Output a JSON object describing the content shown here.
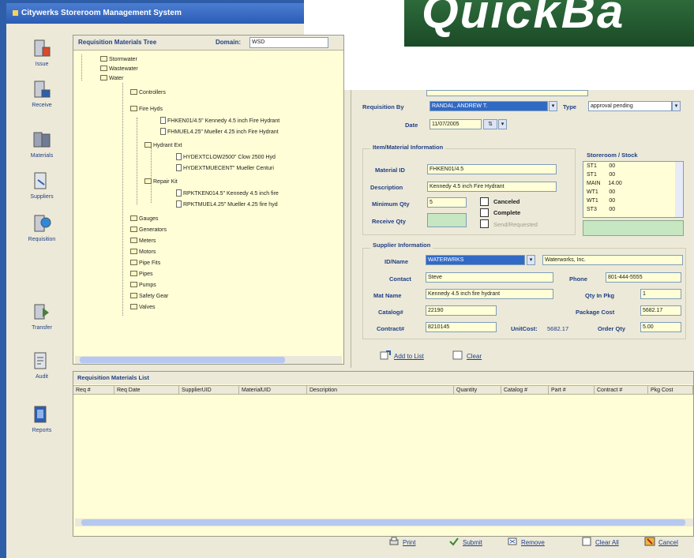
{
  "window": {
    "title": "Citywerks Storeroom Management System"
  },
  "logo": {
    "text": "QuickBa"
  },
  "toolbar": [
    {
      "label": "Issue",
      "icon": "issue-icon"
    },
    {
      "label": "Receive",
      "icon": "receive-icon"
    },
    {
      "label": "Materials",
      "icon": "materials-icon"
    },
    {
      "label": "Suppliers",
      "icon": "suppliers-icon"
    },
    {
      "label": "Requisition",
      "icon": "requisition-icon"
    },
    {
      "label": "Transfer",
      "icon": "transfer-icon"
    },
    {
      "label": "Audit",
      "icon": "audit-icon"
    },
    {
      "label": "Reports",
      "icon": "reports-icon"
    }
  ],
  "tree": {
    "title": "Requisition Materials Tree",
    "domain_label": "Domain:",
    "domain_value": "WSD",
    "nodes": [
      "Stormwater",
      "Wastewater",
      "Water",
      "Controllers",
      "Fire Hyds",
      "FHKEN01/4.5\" Kennedy 4.5 inch Fire Hydrant",
      "FHMUEL4.25\" Mueller 4.25 inch Fire Hydrant",
      "Hydrant Ext",
      "HYDEXTCLOW2500\" Clow 2500 Hyd",
      "HYDEXTMUECENT\" Mueller Centuri",
      "Repair Kit",
      "RPKTKEN014.5\" Kennedy 4.5 inch fire",
      "RPKTMUEL4.25\" Mueller 4.25 fire hyd",
      "Gauges",
      "Generators",
      "Meters",
      "Motors",
      "Pipe Fits",
      "Pipes",
      "Pumps",
      "Safety Gear",
      "Valves"
    ]
  },
  "form": {
    "requisition_by_label": "Requisition By",
    "requisition_by_value": "RANDAL, ANDREW T.",
    "type_label": "Type",
    "type_value": "approval pending",
    "date_label": "Date",
    "date_value": "11/07/2005",
    "item_section_title": "Item/Material Information",
    "material_id_label": "Material ID",
    "material_id_value": "FHKEN01/4.5",
    "description_label": "Description",
    "description_value": "Kennedy 4.5 inch Fire Hydrant",
    "min_qty_label": "Minimum Qty",
    "min_qty_value": "5",
    "receive_qty_label": "Receive Qty",
    "receive_qty_value": "",
    "canceled_label": "Canceled",
    "complete_label": "Complete",
    "third_check_label": "Send/Requested",
    "stock_title": "Storeroom / Stock",
    "stock_rows": [
      {
        "store": "ST1",
        "qty": "00"
      },
      {
        "store": "ST1",
        "qty": "00"
      },
      {
        "store": "MAIN",
        "qty": "14.00"
      },
      {
        "store": "WT1",
        "qty": "00"
      },
      {
        "store": "WT1",
        "qty": "00"
      },
      {
        "store": "ST3",
        "qty": "00"
      }
    ],
    "supplier_section_title": "Supplier Information",
    "id_name_label": "ID/Name",
    "id_value": "WATERWRKS",
    "name_value": "Waterworks, Inc.",
    "contact_label": "Contact",
    "contact_value": "Steve",
    "phone_label": "Phone",
    "phone_value": "801-444-5555",
    "mat_name_label": "Mat Name",
    "mat_name_value": "Kennedy 4.5 inch fire hydrant",
    "qty_in_pkg_label": "Qty In Pkg",
    "qty_in_pkg_value": "1",
    "catalog_label": "Catalog#",
    "catalog_value": "22190",
    "package_cost_label": "Package Cost",
    "package_cost_value": "5682.17",
    "contract_label": "Contract#",
    "contract_value": "8210145",
    "unit_cost_label": "UnitCost:",
    "unit_cost_value": "5682.17",
    "order_qty_label": "Order Qty",
    "order_qty_value": "5.00",
    "add_to_list_label": "Add to List",
    "clear_label": "Clear"
  },
  "list": {
    "title": "Requisition Materials List",
    "columns": [
      "Req #",
      "Req Date",
      "SupplierUID",
      "MaterialUID",
      "Description",
      "Quantity",
      "Catalog #",
      "Part #",
      "Contract #",
      "Pkg Cost"
    ]
  },
  "bottom_actions": {
    "print": "Print",
    "submit": "Submit",
    "remove": "Remove",
    "clear_all": "Clear All",
    "cancel": "Cancel"
  }
}
